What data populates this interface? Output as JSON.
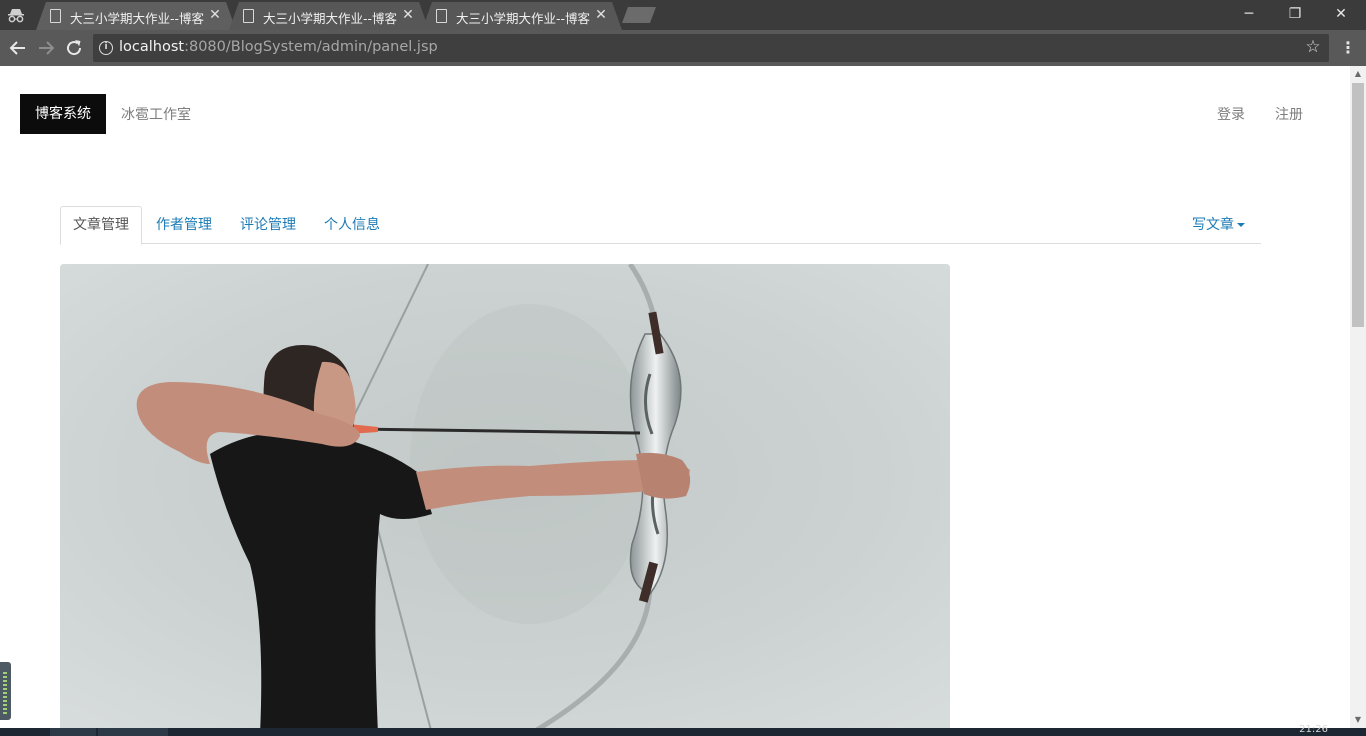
{
  "browser": {
    "tabs": [
      {
        "title": "大三小学期大作业--博客系统",
        "active": true
      },
      {
        "title": "大三小学期大作业--博客系统",
        "active": false
      },
      {
        "title": "大三小学期大作业--博客系统",
        "active": false
      }
    ],
    "close_glyph": "✕",
    "url_host": "localhost",
    "url_path": ":8080/BlogSystem/admin/panel.jsp",
    "window_controls": {
      "minimize": "─",
      "restore": "❐",
      "close": "✕"
    }
  },
  "navbar": {
    "brand": "博客系统",
    "studio": "冰雹工作室",
    "login": "登录",
    "register": "注册"
  },
  "tabs": {
    "items": [
      "文章管理",
      "作者管理",
      "评论管理",
      "个人信息"
    ],
    "active_index": 0,
    "write": "写文章"
  },
  "hero": {
    "subject": "archer-drawing-bow-photo"
  },
  "taskbar": {
    "clock": "21:26"
  }
}
